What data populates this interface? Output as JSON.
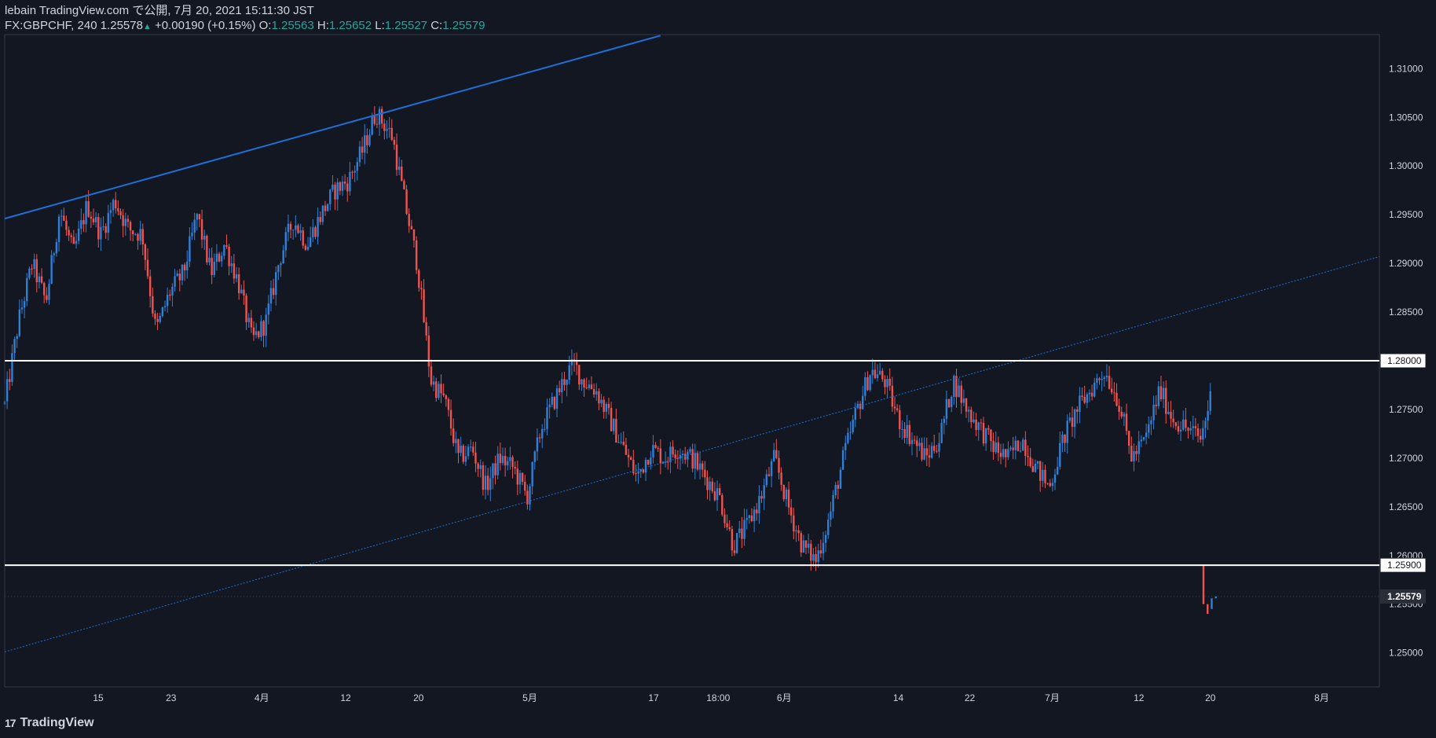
{
  "header": {
    "publisher": "lebain TradingView.com で公開, 7月 20, 2021 15:11:30 JST",
    "symbol": "FX:GBPCHF, 240",
    "last": "1.25578",
    "change_arrow": "▲",
    "change": "+0.00190 (+0.15%)",
    "o_label": "O:",
    "o_value": "1.25563",
    "h_label": "H:",
    "h_value": "1.25652",
    "l_label": "L:",
    "l_value": "1.25527",
    "c_label": "C:",
    "c_value": "1.25579"
  },
  "footer": {
    "brand": "TradingView",
    "logo": "17"
  },
  "colors": {
    "background": "#131722",
    "up": "#2f80d6",
    "down": "#ef5350",
    "trendline": "#1e6fd9",
    "level": "#ffffff",
    "accent_green": "#26a69a"
  },
  "chart_data": {
    "type": "candlestick",
    "instrument": "FX:GBPCHF",
    "timeframe": "240",
    "ylim": [
      1.2465,
      1.3135
    ],
    "y_ticks": [
      "1.25000",
      "1.25500",
      "1.26000",
      "1.26500",
      "1.27000",
      "1.27500",
      "1.28000",
      "1.28500",
      "1.29000",
      "1.29500",
      "1.30000",
      "1.30500",
      "1.31000"
    ],
    "x_ticks": [
      {
        "label": "15",
        "x": 0.068
      },
      {
        "label": "23",
        "x": 0.121
      },
      {
        "label": "4月",
        "x": 0.187
      },
      {
        "label": "12",
        "x": 0.248
      },
      {
        "label": "20",
        "x": 0.301
      },
      {
        "label": "5月",
        "x": 0.382
      },
      {
        "label": "17",
        "x": 0.472
      },
      {
        "label": "18:00",
        "x": 0.519
      },
      {
        "label": "6月",
        "x": 0.567
      },
      {
        "label": "14",
        "x": 0.65
      },
      {
        "label": "22",
        "x": 0.702
      },
      {
        "label": "7月",
        "x": 0.762
      },
      {
        "label": "12",
        "x": 0.825
      },
      {
        "label": "20",
        "x": 0.877
      },
      {
        "label": "8月",
        "x": 0.958
      }
    ],
    "horizontal_levels": [
      {
        "price": 1.28,
        "label": "1.28000"
      },
      {
        "price": 1.259,
        "label": "1.25900"
      }
    ],
    "last_price": {
      "price": 1.25579,
      "label": "1.25579"
    },
    "trendlines": [
      {
        "style": "solid",
        "from": {
          "x": 0.0,
          "price": 1.2946
        },
        "to": {
          "x": 0.477,
          "price": 1.3134
        }
      },
      {
        "style": "dotted",
        "from": {
          "x": 0.0,
          "price": 1.2501
        },
        "to": {
          "x": 1.0,
          "price": 1.2907
        }
      }
    ],
    "path_anchors": [
      [
        0.0,
        1.2755
      ],
      [
        0.01,
        1.284
      ],
      [
        0.02,
        1.29
      ],
      [
        0.03,
        1.286
      ],
      [
        0.04,
        1.2955
      ],
      [
        0.05,
        1.291
      ],
      [
        0.06,
        1.296
      ],
      [
        0.07,
        1.293
      ],
      [
        0.08,
        1.2965
      ],
      [
        0.09,
        1.2935
      ],
      [
        0.1,
        1.293
      ],
      [
        0.11,
        1.283
      ],
      [
        0.12,
        1.287
      ],
      [
        0.13,
        1.289
      ],
      [
        0.14,
        1.295
      ],
      [
        0.15,
        1.289
      ],
      [
        0.16,
        1.292
      ],
      [
        0.17,
        1.288
      ],
      [
        0.18,
        1.282
      ],
      [
        0.19,
        1.284
      ],
      [
        0.2,
        1.2905
      ],
      [
        0.21,
        1.2945
      ],
      [
        0.22,
        1.292
      ],
      [
        0.23,
        1.295
      ],
      [
        0.24,
        1.2975
      ],
      [
        0.25,
        1.2985
      ],
      [
        0.26,
        1.3015
      ],
      [
        0.27,
        1.3055
      ],
      [
        0.275,
        1.3045
      ],
      [
        0.282,
        1.303
      ],
      [
        0.29,
        1.297
      ],
      [
        0.3,
        1.29
      ],
      [
        0.31,
        1.278
      ],
      [
        0.32,
        1.276
      ],
      [
        0.33,
        1.27
      ],
      [
        0.34,
        1.271
      ],
      [
        0.35,
        1.267
      ],
      [
        0.36,
        1.27
      ],
      [
        0.37,
        1.269
      ],
      [
        0.38,
        1.266
      ],
      [
        0.39,
        1.273
      ],
      [
        0.4,
        1.276
      ],
      [
        0.41,
        1.279
      ],
      [
        0.415,
        1.2795
      ],
      [
        0.42,
        1.278
      ],
      [
        0.43,
        1.277
      ],
      [
        0.44,
        1.274
      ],
      [
        0.45,
        1.271
      ],
      [
        0.46,
        1.268
      ],
      [
        0.47,
        1.271
      ],
      [
        0.48,
        1.27
      ],
      [
        0.49,
        1.271
      ],
      [
        0.5,
        1.27
      ],
      [
        0.51,
        1.268
      ],
      [
        0.52,
        1.266
      ],
      [
        0.53,
        1.261
      ],
      [
        0.54,
        1.263
      ],
      [
        0.55,
        1.266
      ],
      [
        0.56,
        1.27
      ],
      [
        0.57,
        1.265
      ],
      [
        0.58,
        1.261
      ],
      [
        0.59,
        1.2595
      ],
      [
        0.6,
        1.264
      ],
      [
        0.61,
        1.27
      ],
      [
        0.62,
        1.275
      ],
      [
        0.63,
        1.279
      ],
      [
        0.64,
        1.278
      ],
      [
        0.65,
        1.274
      ],
      [
        0.66,
        1.272
      ],
      [
        0.67,
        1.27
      ],
      [
        0.68,
        1.272
      ],
      [
        0.69,
        1.278
      ],
      [
        0.7,
        1.275
      ],
      [
        0.71,
        1.273
      ],
      [
        0.72,
        1.271
      ],
      [
        0.73,
        1.27
      ],
      [
        0.74,
        1.272
      ],
      [
        0.75,
        1.269
      ],
      [
        0.76,
        1.267
      ],
      [
        0.77,
        1.272
      ],
      [
        0.78,
        1.275
      ],
      [
        0.79,
        1.277
      ],
      [
        0.8,
        1.279
      ],
      [
        0.81,
        1.276
      ],
      [
        0.82,
        1.27
      ],
      [
        0.83,
        1.272
      ],
      [
        0.84,
        1.277
      ],
      [
        0.85,
        1.274
      ],
      [
        0.86,
        1.273
      ],
      [
        0.87,
        1.272
      ],
      [
        0.88,
        1.278
      ],
      [
        0.89,
        1.275
      ],
      [
        0.9,
        1.27
      ],
      [
        0.91,
        1.266
      ],
      [
        0.92,
        1.268
      ],
      [
        0.93,
        1.269
      ],
      [
        0.94,
        1.27
      ],
      [
        0.95,
        1.268
      ],
      [
        0.96,
        1.264
      ],
      [
        0.97,
        1.266
      ],
      [
        0.98,
        1.27
      ],
      [
        0.99,
        1.276
      ],
      [
        1.0,
        1.277
      ]
    ],
    "grid": false,
    "legend": "none"
  }
}
